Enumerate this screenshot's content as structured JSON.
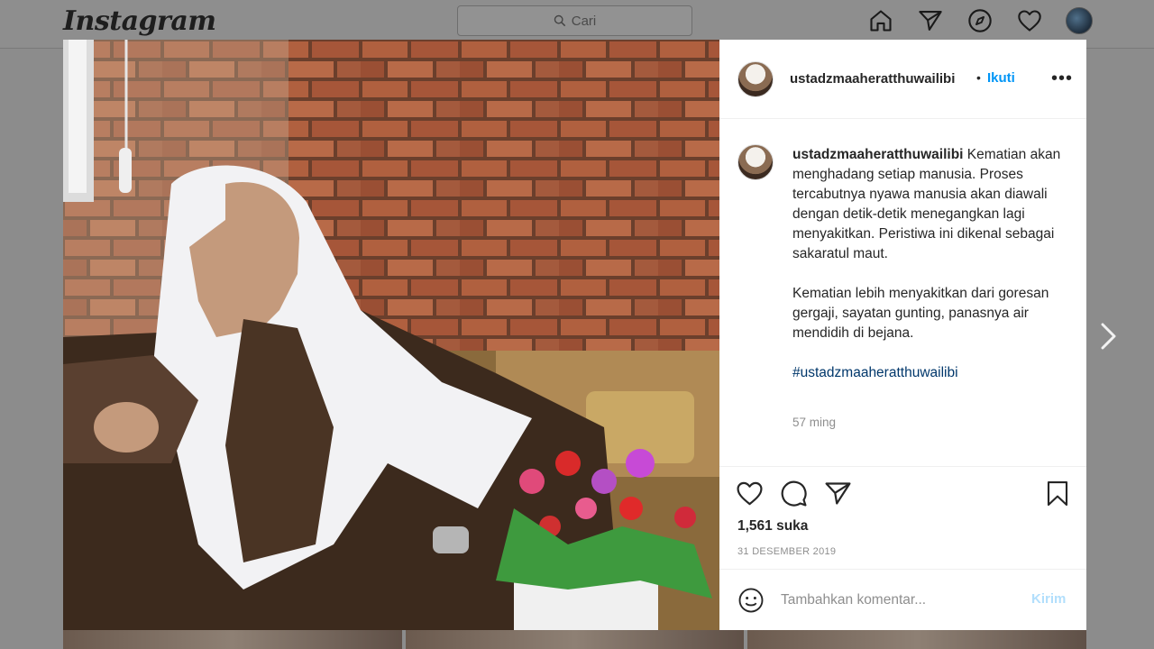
{
  "app": {
    "logo": "Instagram"
  },
  "search": {
    "placeholder": "Cari"
  },
  "nav": {
    "icons": [
      "home-icon",
      "direct-icon",
      "explore-icon",
      "activity-icon",
      "profile-avatar"
    ]
  },
  "post": {
    "username": "ustadzmaaheratthuwailibi",
    "follow_separator": "•",
    "follow_label": "Ikuti",
    "more_label": "•••",
    "caption": {
      "paragraph1": "Kematian akan menghadang setiap manusia. Proses tercabutnya nyawa manusia akan diawali dengan detik-detik menegangkan lagi menyakitkan. Peristiwa ini dikenal sebagai sakaratul maut.",
      "paragraph2": "Kematian lebih menyakitkan dari goresan gergaji, sayatan gunting, panasnya air mendidih di bejana.",
      "hashtag": "#ustadzmaaheratthuwailibi"
    },
    "time_ago": "57 ming",
    "likes": "1,561 suka",
    "date": "31 DESEMBER 2019",
    "comment": {
      "placeholder": "Tambahkan komentar...",
      "post_label": "Kirim"
    }
  },
  "colors": {
    "accent": "#0095f6",
    "hashtag": "#00376b",
    "post_disabled": "#b2dffc"
  }
}
